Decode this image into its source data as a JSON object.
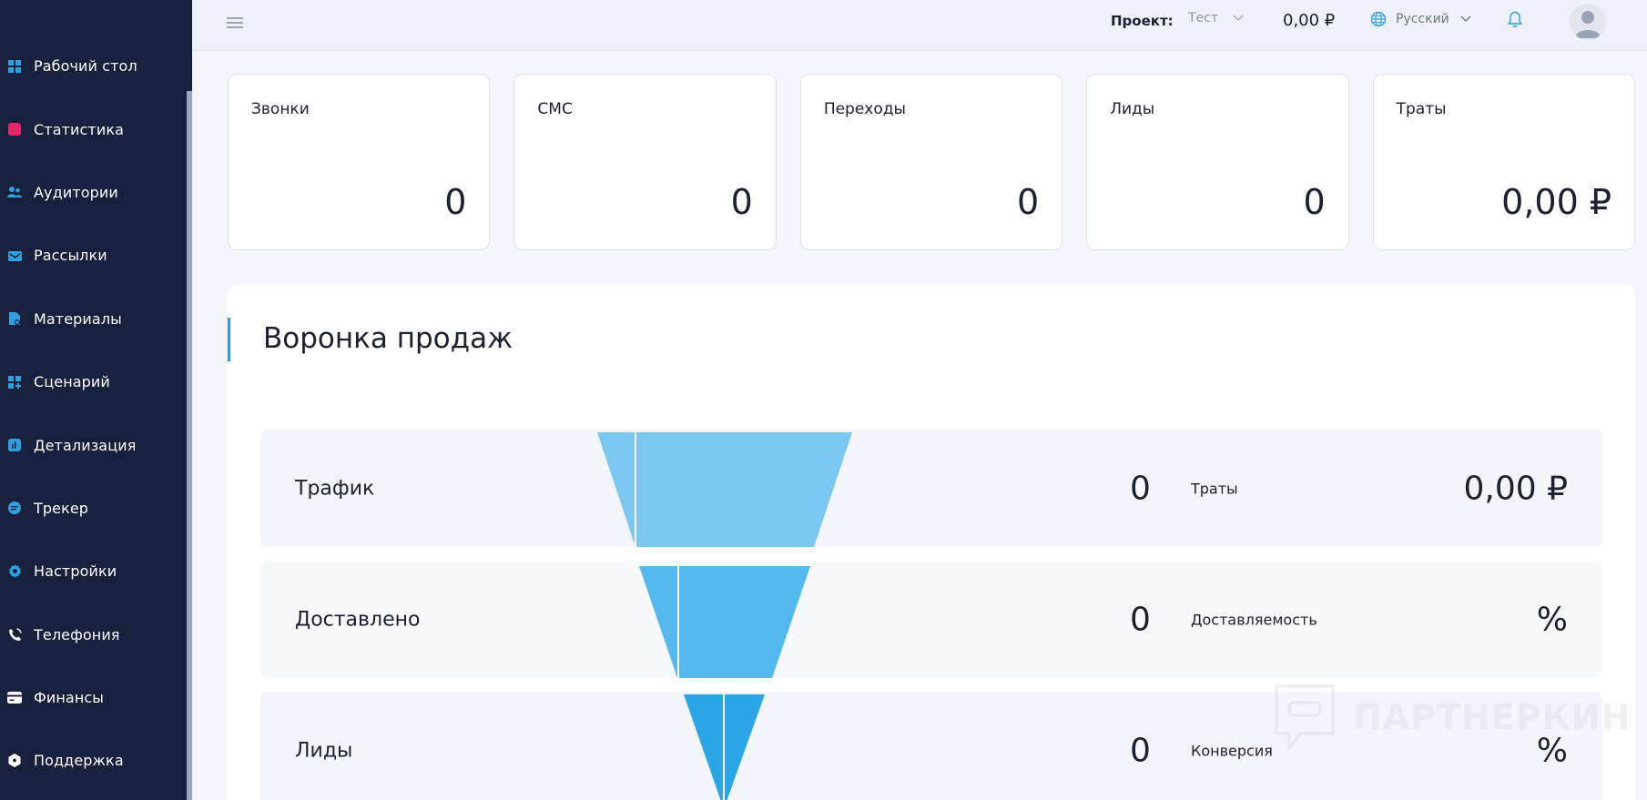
{
  "sidebar": {
    "items": [
      {
        "label": "Рабочий стол",
        "icon": "dashboard-icon",
        "color": "#2f9fe0"
      },
      {
        "label": "Статистика",
        "icon": "statistics-icon",
        "color": "#e8246b"
      },
      {
        "label": "Аудитории",
        "icon": "audience-icon",
        "color": "#2f9fe0"
      },
      {
        "label": "Рассылки",
        "icon": "mailing-icon",
        "color": "#2f9fe0"
      },
      {
        "label": "Материалы",
        "icon": "materials-icon",
        "color": "#2f9fe0"
      },
      {
        "label": "Сценарий",
        "icon": "scenario-icon",
        "color": "#2f9fe0"
      },
      {
        "label": "Детализация",
        "icon": "details-icon",
        "color": "#2f9fe0"
      },
      {
        "label": "Трекер",
        "icon": "tracker-icon",
        "color": "#2f9fe0"
      },
      {
        "label": "Настройки",
        "icon": "settings-icon",
        "color": "#2f9fe0"
      },
      {
        "label": "Телефония",
        "icon": "phone-icon",
        "color": "#ffffff"
      },
      {
        "label": "Финансы",
        "icon": "finance-icon",
        "color": "#ffffff"
      },
      {
        "label": "Поддержка",
        "icon": "support-icon",
        "color": "#ffffff"
      }
    ]
  },
  "header": {
    "project_label": "Проект:",
    "project_value": "Тест",
    "balance": "0,00 ₽",
    "language": "Русский"
  },
  "stats": [
    {
      "title": "Звонки",
      "value": "0"
    },
    {
      "title": "СМС",
      "value": "0"
    },
    {
      "title": "Переходы",
      "value": "0"
    },
    {
      "title": "Лиды",
      "value": "0"
    },
    {
      "title": "Траты",
      "value": "0,00 ₽"
    }
  ],
  "funnel": {
    "title": "Воронка продаж",
    "rows": [
      {
        "label": "Трафик",
        "value": "0",
        "metric_label": "Траты",
        "metric_value": "0,00 ₽",
        "color": "#7ac8f2"
      },
      {
        "label": "Доставлено",
        "value": "0",
        "metric_label": "Доставляемость",
        "metric_value": "%",
        "color": "#53b9ee"
      },
      {
        "label": "Лиды",
        "value": "0",
        "metric_label": "Конверсия",
        "metric_value": "%",
        "color": "#2aa5e6"
      }
    ]
  },
  "watermark": {
    "text": "ПАРТНЕРКИН"
  },
  "colors": {
    "sidebar_bg": "#17213e",
    "accent": "#2f9fe0",
    "page_bg": "#f5f6fb"
  }
}
